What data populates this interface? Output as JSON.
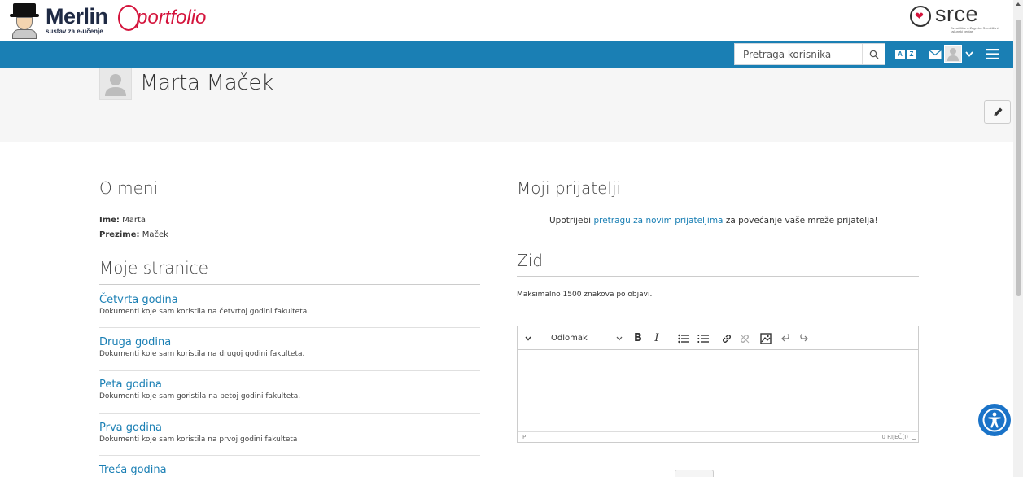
{
  "branding": {
    "merlin_name": "Merlin",
    "merlin_subtitle": "sustav za e-učenje",
    "portfolio_text": "portfolio",
    "srce_text": "srce",
    "srce_small": "Sveučilište u Zagrebu Sveučilišni računski centar"
  },
  "nav": {
    "search_placeholder": "Pretraga korisnika",
    "lang_left": "A",
    "lang_right": "Z"
  },
  "profile": {
    "name": "Marta Maček"
  },
  "about": {
    "title": "O meni",
    "first_label": "Ime:",
    "first_value": "Marta",
    "last_label": "Prezime:",
    "last_value": "Maček"
  },
  "pages": {
    "title": "Moje stranice",
    "items": [
      {
        "title": "Četvrta godina",
        "desc": "Dokumenti koje sam koristila na četvrtoj godini fakulteta."
      },
      {
        "title": "Druga godina",
        "desc": "Dokumenti koje sam koristila na drugoj godini fakulteta."
      },
      {
        "title": "Peta godina",
        "desc": "Dokumenti koje sam goristila na petoj godini fakulteta."
      },
      {
        "title": "Prva godina",
        "desc": "Dokumenti koje sam koristila na prvoj godini fakulteta"
      },
      {
        "title": "Treća godina",
        "desc": ""
      }
    ]
  },
  "friends": {
    "title": "Moji prijatelji",
    "text_before": "Upotrijebi ",
    "link_text": "pretragu za novim prijateljima",
    "text_after": " za povećanje vaše mreže prijatelja!"
  },
  "wall": {
    "title": "Zid",
    "note": "Maksimalno 1500 znakova po objavi.",
    "format_select": "Odlomak",
    "bold": "B",
    "italic": "I",
    "status_path": "P",
    "word_count": "0 RIJEČ(I)"
  },
  "colors": {
    "nav_blue": "#1a7fb4",
    "link_blue": "#1a7fb4",
    "brand_red": "#d4143c"
  }
}
